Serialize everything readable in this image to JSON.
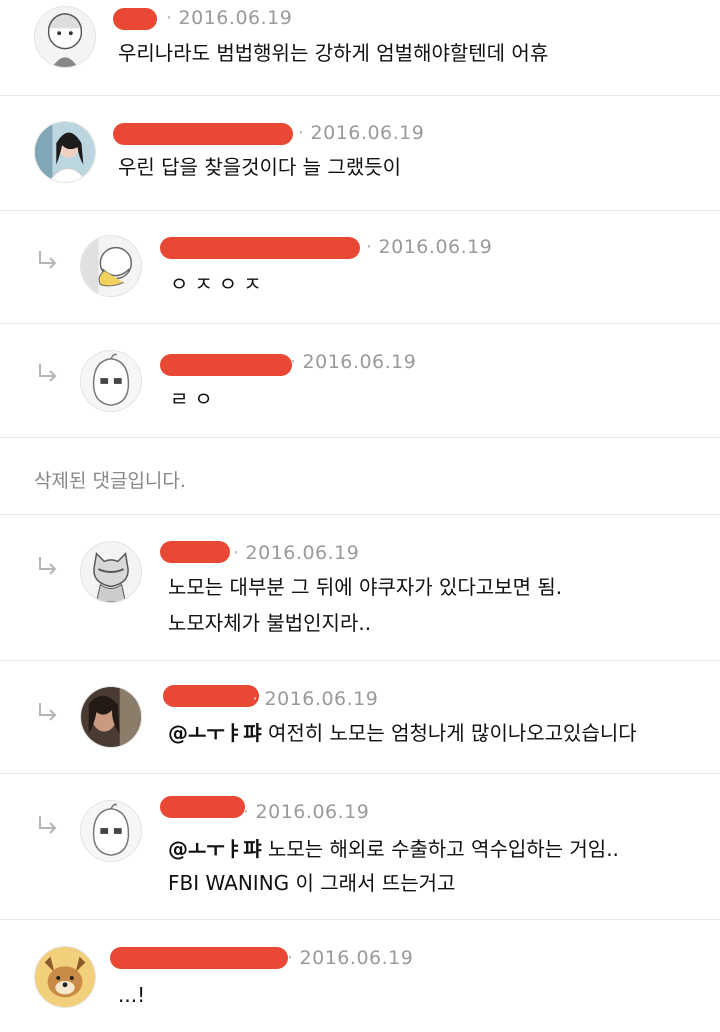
{
  "comments": [
    {
      "date": "2016.06.19",
      "text": "우리나라도 범법행위는 강하게 엄벌해야할텐데 어휴"
    },
    {
      "date": "2016.06.19",
      "text": "우린 답을 찾을것이다 늘 그랬듯이"
    },
    {
      "date": "2016.06.19",
      "text": "ㅇㅈㅇㅈ"
    },
    {
      "date": "2016.06.19",
      "text": "ㄹㅇ"
    },
    {
      "deleted_text": "삭제된 댓글입니다."
    },
    {
      "date": "2016.06.19",
      "lines": [
        "노모는 대부분 그 뒤에 야쿠자가 있다고보면 됨.",
        "노모자체가 불법인지라.."
      ]
    },
    {
      "date": "2016.06.19",
      "mention": "@ㅗㅜㅑ퍄",
      "text": " 여전히 노모는 엄청나게 많이나오고있습니다"
    },
    {
      "date": "2016.06.19",
      "mention": "@ㅗㅜㅑ퍄",
      "lines": [
        " 노모는 해외로 수출하고 역수입하는 거임..",
        "FBI WANING 이 그래서 뜨는거고"
      ]
    },
    {
      "date": "2016.06.19",
      "text": "...!"
    }
  ],
  "colors": {
    "redaction": "#e8412c",
    "date": "#9a9a9a",
    "divider": "#e6e6e6"
  }
}
